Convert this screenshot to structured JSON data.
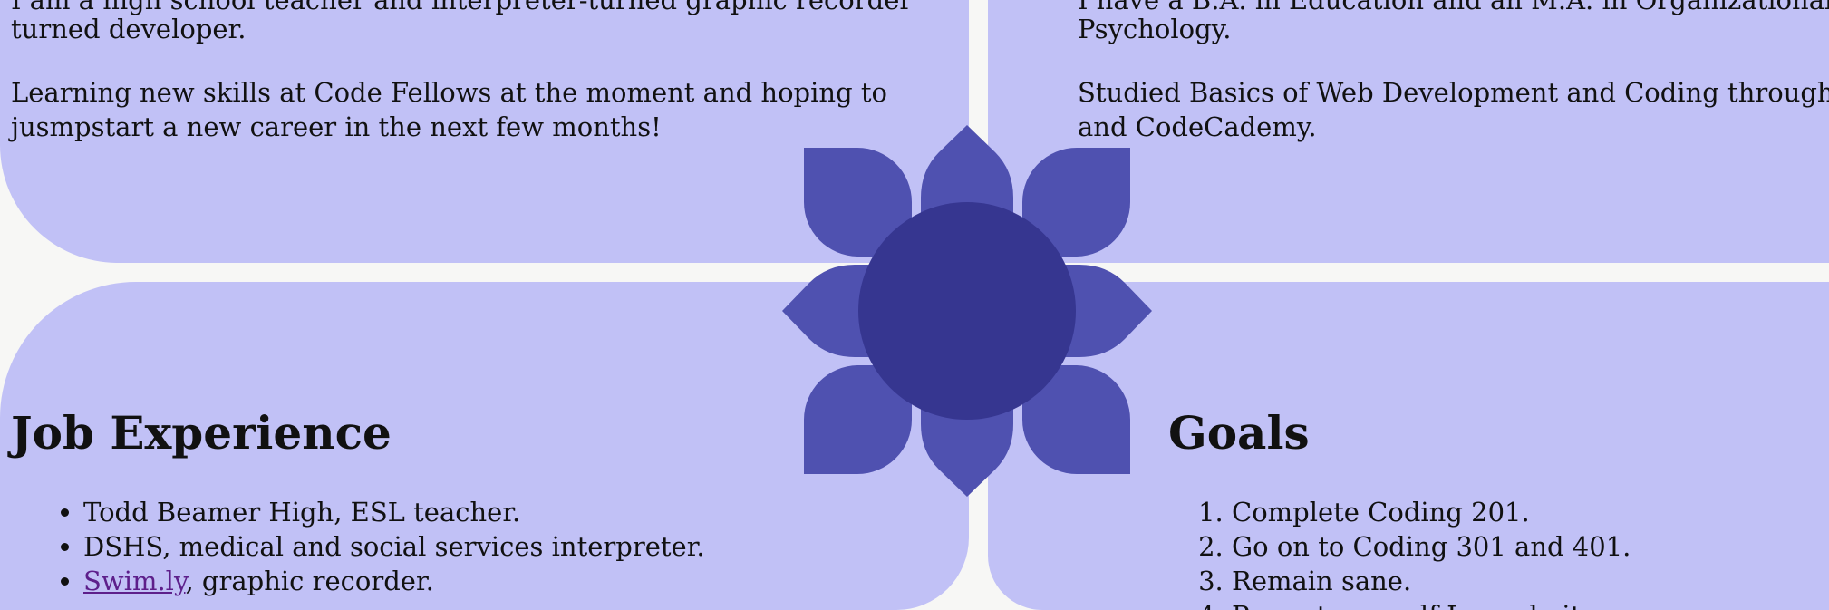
{
  "about": {
    "line1": "I am a high school teacher and interpreter-turned graphic recorder",
    "line2": "turned developer.",
    "line3": "Learning new skills at Code Fellows at the moment and hoping to",
    "line4": "jusmpstart a new career in the next few months!"
  },
  "education": {
    "line1": "I have a B.A. in Education and an M.A. in Organizational",
    "line2": "Psychology.",
    "line3": "Studied Basics of Web Development and Coding through Code",
    "line4": "and CodeCademy."
  },
  "job_experience": {
    "title": "Job Experience",
    "items": [
      {
        "text": "Todd Beamer High, ESL teacher."
      },
      {
        "text": "DSHS, medical and social services interpreter."
      },
      {
        "link": "Swim.ly",
        "text": ", graphic recorder."
      }
    ]
  },
  "goals": {
    "title": "Goals",
    "items": [
      "Complete Coding 201.",
      "Go on to Coding 301 and 401.",
      "Remain sane.",
      "Prove to myself I can do it."
    ]
  },
  "colors": {
    "panel": "#c1c1f6",
    "petal": "#4f51b0",
    "flower_center": "#363690",
    "background": "#f7f7f5"
  }
}
